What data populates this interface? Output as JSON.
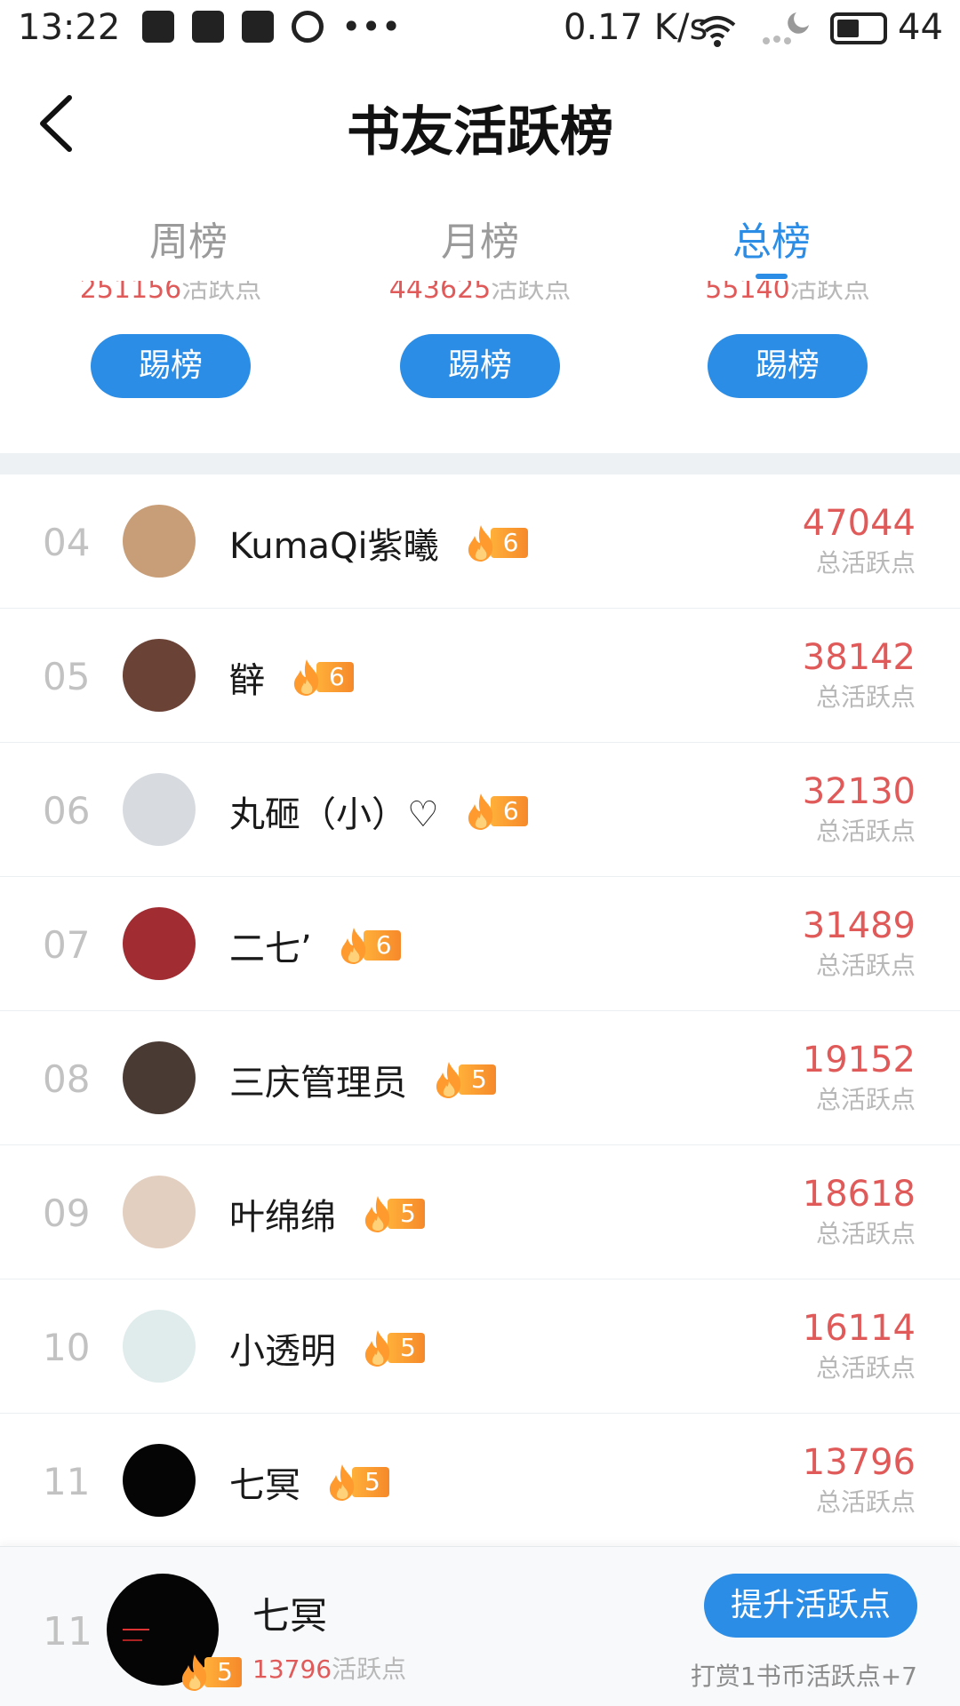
{
  "status_bar": {
    "time": "13:22",
    "speed": "0.17 K/s",
    "battery": "44",
    "icons": [
      "qq-icon",
      "video-icon",
      "image-icon",
      "pause-icon",
      "more-dots-icon",
      "wifi-icon",
      "night-mode-icon",
      "battery-icon"
    ]
  },
  "header": {
    "title": "书友活跃榜"
  },
  "tabs": [
    {
      "label": "周榜",
      "active": false
    },
    {
      "label": "月榜",
      "active": false
    },
    {
      "label": "总榜",
      "active": true
    }
  ],
  "podium": [
    {
      "points": "251156",
      "label": "活跃点",
      "button": "踢榜"
    },
    {
      "points": "443625",
      "label": "活跃点",
      "button": "踢榜"
    },
    {
      "points": "55140",
      "label": "活跃点",
      "button": "踢榜"
    }
  ],
  "list": [
    {
      "rank": "04",
      "name": "KumaQi紫曦",
      "level": "6",
      "points": "47044",
      "label": "总活跃点",
      "avatar_color": "#c89e78"
    },
    {
      "rank": "05",
      "name": "辥",
      "level": "6",
      "points": "38142",
      "label": "总活跃点",
      "avatar_color": "#6b4236"
    },
    {
      "rank": "06",
      "name": "丸砸（小）♡",
      "level": "6",
      "points": "32130",
      "label": "总活跃点",
      "avatar_color": "#d7dbe0"
    },
    {
      "rank": "07",
      "name": "二七’",
      "level": "6",
      "points": "31489",
      "label": "总活跃点",
      "avatar_color": "#a12d33"
    },
    {
      "rank": "08",
      "name": "三庆管理员",
      "level": "5",
      "points": "19152",
      "label": "总活跃点",
      "avatar_color": "#4a3a34"
    },
    {
      "rank": "09",
      "name": "叶绵绵",
      "level": "5",
      "points": "18618",
      "label": "总活跃点",
      "avatar_color": "#e3cfc0"
    },
    {
      "rank": "10",
      "name": "小透明",
      "level": "5",
      "points": "16114",
      "label": "总活跃点",
      "avatar_color": "#dfeceb"
    },
    {
      "rank": "11",
      "name": "七冥",
      "level": "5",
      "points": "13796",
      "label": "总活跃点",
      "avatar_color": "#050505"
    }
  ],
  "me": {
    "rank": "11",
    "name": "七冥",
    "level": "5",
    "points": "13796",
    "points_label": "活跃点",
    "button": "提升活跃点",
    "note": "打赏1书币活跃点+7"
  },
  "colors": {
    "accent": "#2b8de6",
    "points": "#e05a5a",
    "badge": "#f6892a"
  }
}
